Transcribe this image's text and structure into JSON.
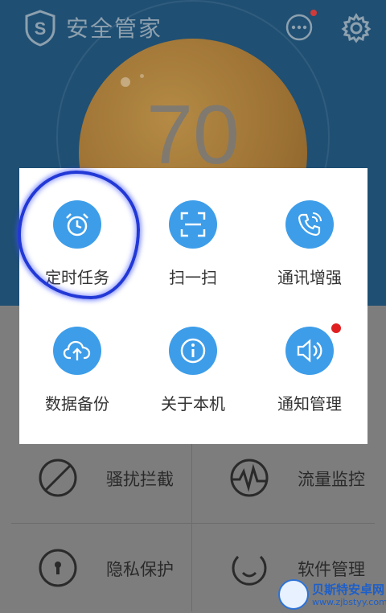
{
  "app": {
    "title": "安全管家",
    "score": "70"
  },
  "popup": {
    "items": [
      {
        "label": "定时任务",
        "icon": "alarm-clock-icon"
      },
      {
        "label": "扫一扫",
        "icon": "scan-icon"
      },
      {
        "label": "通讯增强",
        "icon": "phone-enhance-icon"
      },
      {
        "label": "数据备份",
        "icon": "cloud-upload-icon"
      },
      {
        "label": "关于本机",
        "icon": "info-icon"
      },
      {
        "label": "通知管理",
        "icon": "speaker-icon",
        "badge": true
      }
    ]
  },
  "tiles": [
    {
      "label": "骚扰拦截",
      "icon": "block-icon"
    },
    {
      "label": "流量监控",
      "icon": "traffic-wave-icon"
    },
    {
      "label": "隐私保护",
      "icon": "privacy-lock-icon"
    },
    {
      "label": "软件管理",
      "icon": "software-icon"
    }
  ],
  "watermark": {
    "title": "贝斯特安卓网",
    "url": "www.zjbstyy.com"
  },
  "colors": {
    "accent": "#3d9de9",
    "highlight": "#2238d6",
    "badge": "#e02020"
  }
}
